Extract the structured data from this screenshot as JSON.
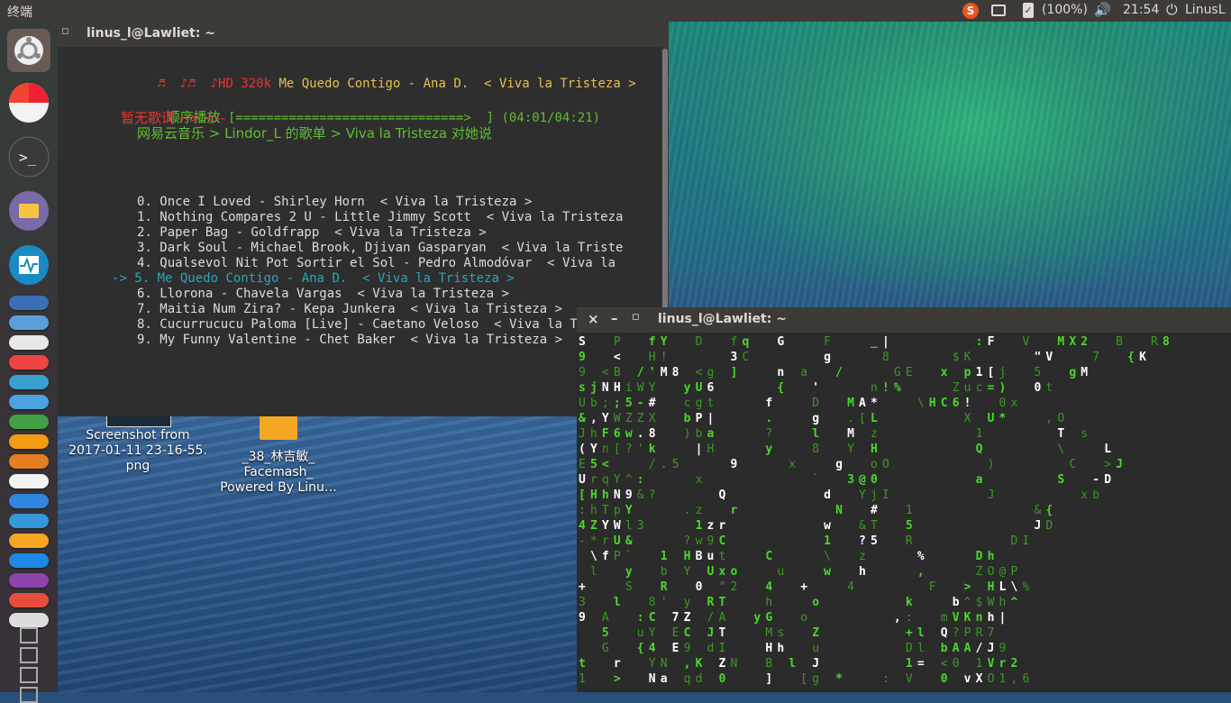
{
  "top_panel": {
    "app_title": "终端",
    "battery": "(100%)",
    "clock": "21:54",
    "user": "LinusL",
    "icons": [
      "sougou-input-icon",
      "chat-icon",
      "battery-icon",
      "volume-icon",
      "session-icon"
    ]
  },
  "launcher": {
    "icons": [
      "ubuntu-dash-icon",
      "screenshot-app-icon",
      "terminal-app-icon",
      "files-app-icon",
      "system-monitor-app-icon"
    ],
    "small_icons": [
      "app-icon-1",
      "app-icon-2",
      "app-icon-3",
      "app-icon-4",
      "app-icon-5",
      "app-icon-6",
      "app-icon-7",
      "app-icon-8",
      "app-icon-9",
      "app-icon-10",
      "app-icon-11",
      "app-icon-12",
      "app-icon-13",
      "app-icon-14",
      "app-icon-15",
      "app-icon-16",
      "app-icon-17"
    ]
  },
  "terminal1": {
    "title": "linus_l@Lawliet: ~",
    "now_playing": {
      "notes": "♬  ♪♬  ♪",
      "quality": "HD 320k",
      "track": "Me Quedo Contigo - Ana D.  < Viva la Tristeza >"
    },
    "play_mode": "顺序播放",
    "progress_bar": "[==============================>  ]",
    "progress_time": "(04:01/04:21)",
    "progress": 0.92,
    "no_lyrics": "暂无歌词 --> <--",
    "breadcrumb": "网易云音乐 > Lindor_L 的歌单 > Viva la Tristeza 对她说",
    "tracks": [
      "0. Once I Loved - Shirley Horn  < Viva la Tristeza >",
      "1. Nothing Compares 2 U - Little Jimmy Scott  < Viva la Tristeza",
      "2. Paper Bag - Goldfrapp  < Viva la Tristeza >",
      "3. Dark Soul - Michael Brook, Djivan Gasparyan  < Viva la Triste",
      "4. Qualsevol Nit Pot Sortir el Sol - Pedro Almodóvar  < Viva la",
      "5. Me Quedo Contigo - Ana D.  < Viva la Tristeza >",
      "6. Llorona - Chavela Vargas  < Viva la Tristeza >",
      "7. Maitia Num Zira? - Kepa Junkera  < Viva la Tristeza >",
      "8. Cucurrucucu Paloma [Live] - Caetano Veloso  < Viva la Tristez",
      "9. My Funny Valentine - Chet Baker  < Viva la Tristeza >"
    ],
    "selected_marker": "->",
    "selected_index": 5
  },
  "desktop": {
    "icon1_label_line1": "Screenshot from",
    "icon1_label_line2": "2017-01-11 23-16-55.",
    "icon1_label_line3": "png",
    "icon2_label_line1": "_38_林吉敏_",
    "icon2_label_line2": "Facemash_",
    "icon2_label_line3": "Powered By Linu…"
  },
  "terminal2": {
    "title": "linus_l@Lawliet: ~",
    "close_glyph": "×",
    "minimize_glyph": "–",
    "maximize_glyph": "▫",
    "matrix_rows": [
      "S  P  fY  D  fq  G   F   _|       :F  V  MX2  B  R8",
      "9  <  H!     3C      g    8     $K     \"V   7  {K",
      "9 <B /'M8 <g ]   n a  /    GE  x p1[j  5  gM",
      "sjNHiWY  yU6     {  '    n!%    Zuc=)  0t",
      "Ub;;5-#  cgt    f   D  MA*   \\HC6!  0x",
      "&,YWZZX  bP|    .   g  .[L       X U*   ,O",
      "JhF6w.8  )ba    ?   l  M z        1      T s",
      "(Yn[?'k   |H    y   8  Y H        Q      \\   L",
      "E5<   /.5    9    x   g  oO        )      C  >J",
      "UrqY^:    x         `  3@0        a      S  -D",
      "[HhN9&?     Q        d  YjI        J       xb",
      ":hTpY    .z  r        N  #  1          &{",
      "4ZYWl3    1zr        w  &T  5          JD",
      "-*rU&    ?w9C        1  ?5  R        DI",
      " \\fP`  1 HBut   C    \\  z    %    Dh",
      " l  y  b Y Uxo   u   w  h    ,    ZO@P",
      "+   S  R  0 \"2  4  +   4      F  > HL\\%",
      "3  l  8' y RT   h   o       k   b^$Wh^",
      "9 A  :C 7Z /A  yG  o       ,:  mVKnh|",
      "  5  uY EC JT   Ms  Z       +l Q?PR7",
      "  G  {4 E9 dI   Hh  u       Dl bAA/J9",
      "t  r  YN ,K ZN  B l J       1= <0 1Vr2",
      "1  >  Na qd 0   ]  [g *   : V  0 vXO1,6"
    ]
  }
}
